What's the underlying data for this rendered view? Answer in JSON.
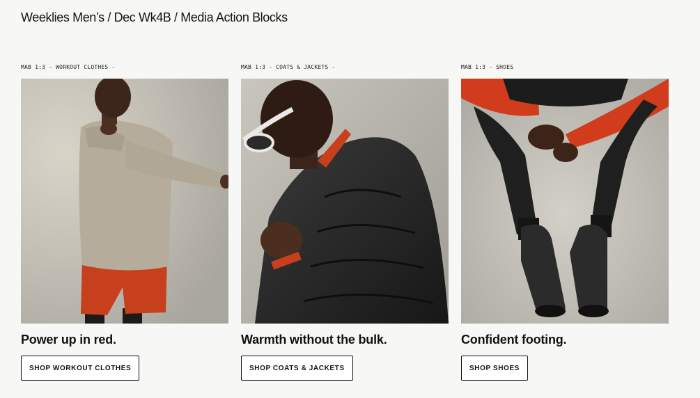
{
  "breadcrumb": "Weeklies Men’s / Dec Wk4B / Media Action Blocks",
  "blocks": [
    {
      "label": "MAB 1:3 - WORKOUT CLOTHES -",
      "headline": "Power up in red.",
      "button": "SHOP WORKOUT CLOTHES",
      "image_desc": "man stretching in long-sleeve top and red shorts"
    },
    {
      "label": "MAB 1:3 - COATS & JACKETS -",
      "headline": "Warmth without the bulk.",
      "button": "SHOP COATS & JACKETS",
      "image_desc": "man in black puffer jacket and sunglasses"
    },
    {
      "label": "MAB 1:3 - SHOES",
      "headline": "Confident footing.",
      "button": "SHOP SHOES",
      "image_desc": "legs in black joggers and black running shoes"
    }
  ],
  "colors": {
    "page_bg": "#f7f7f5",
    "accent_red": "#d6431f",
    "text": "#111111"
  }
}
